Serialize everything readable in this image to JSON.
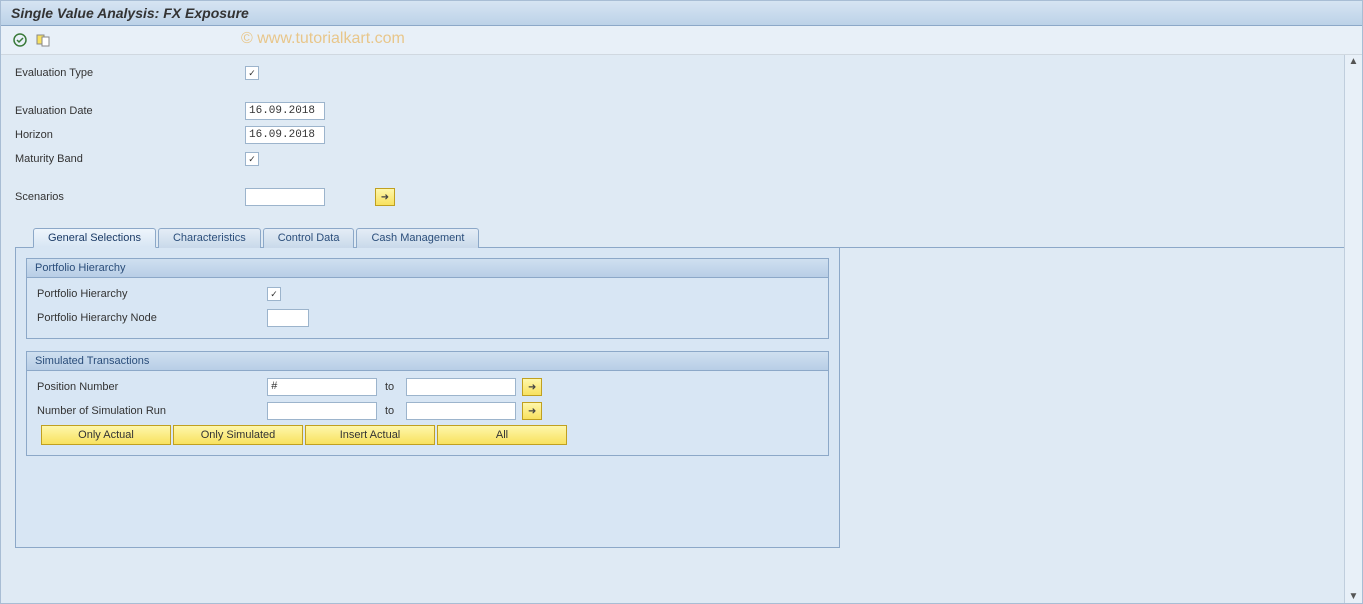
{
  "header": {
    "title": "Single Value Analysis: FX Exposure",
    "watermark": "© www.tutorialkart.com"
  },
  "top_fields": {
    "evaluation_type": {
      "label": "Evaluation Type",
      "checked": true
    },
    "evaluation_date": {
      "label": "Evaluation Date",
      "value": "16.09.2018"
    },
    "horizon": {
      "label": "Horizon",
      "value": "16.09.2018"
    },
    "maturity_band": {
      "label": "Maturity Band",
      "checked": true
    },
    "scenarios": {
      "label": "Scenarios",
      "value": ""
    }
  },
  "tabs": {
    "general": "General Selections",
    "characteristics": "Characteristics",
    "control": "Control Data",
    "cash": "Cash Management"
  },
  "portfolio_group": {
    "title": "Portfolio Hierarchy",
    "hierarchy": {
      "label": "Portfolio Hierarchy",
      "checked": true
    },
    "node": {
      "label": "Portfolio Hierarchy Node",
      "value": ""
    }
  },
  "simulated_group": {
    "title": "Simulated Transactions",
    "position_number": {
      "label": "Position Number",
      "from": "#",
      "to_label": "to",
      "to": ""
    },
    "simulation_run": {
      "label": "Number of Simulation Run",
      "from": "",
      "to_label": "to",
      "to": ""
    },
    "buttons": {
      "only_actual": "Only Actual",
      "only_simulated": "Only Simulated",
      "insert_actual": "Insert Actual",
      "all": "All"
    }
  }
}
